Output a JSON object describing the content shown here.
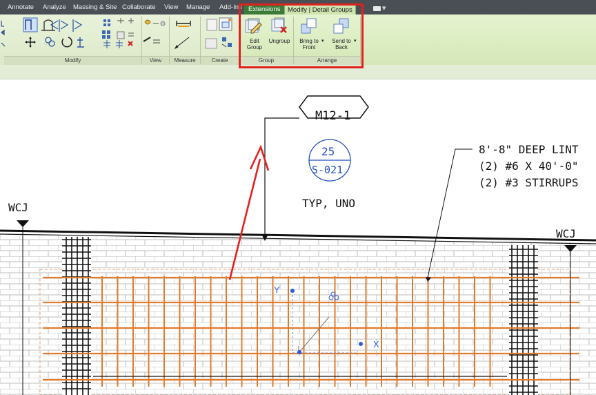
{
  "tabs": [
    {
      "label": "Annotate"
    },
    {
      "label": "Analyze"
    },
    {
      "label": "Massing & Site"
    },
    {
      "label": "Collaborate"
    },
    {
      "label": "View"
    },
    {
      "label": "Manage"
    },
    {
      "label": "Add-Ins"
    },
    {
      "label": "Extensions"
    },
    {
      "label": "Modify | Detail Groups"
    }
  ],
  "ribbon": {
    "panels": {
      "modify": "Modify",
      "view": "View",
      "measure": "Measure",
      "create": "Create",
      "group": "Group",
      "arrange": "Arrange"
    },
    "group_buttons": {
      "edit_group": "Edit Group",
      "edit_line1": "Edit",
      "edit_line2": "Group",
      "ungroup": "Ungroup"
    },
    "arrange_buttons": {
      "bring_to_front_1": "Bring to",
      "bring_to_front_2": "Front",
      "send_to_back_1": "Send to",
      "send_to_back_2": "Back"
    }
  },
  "drawing": {
    "tag": "M12-1",
    "section_number": "25",
    "section_sheet": "S-021",
    "typ_note": "TYP, UNO",
    "note_line1": "8'-8\" DEEP LINT",
    "note_line2": "(2) #6 X 40'-0\"",
    "note_line3": "(2) #3 STIRRUPS",
    "wcj_left": "WCJ",
    "wcj_right": "WCJ",
    "axis_y": "Y",
    "axis_x": "X"
  },
  "colors": {
    "rebar": "#e07b2b",
    "highlight": "#e0211e",
    "axis": "#2a5fd8",
    "section_blue": "#1f4fc2"
  }
}
